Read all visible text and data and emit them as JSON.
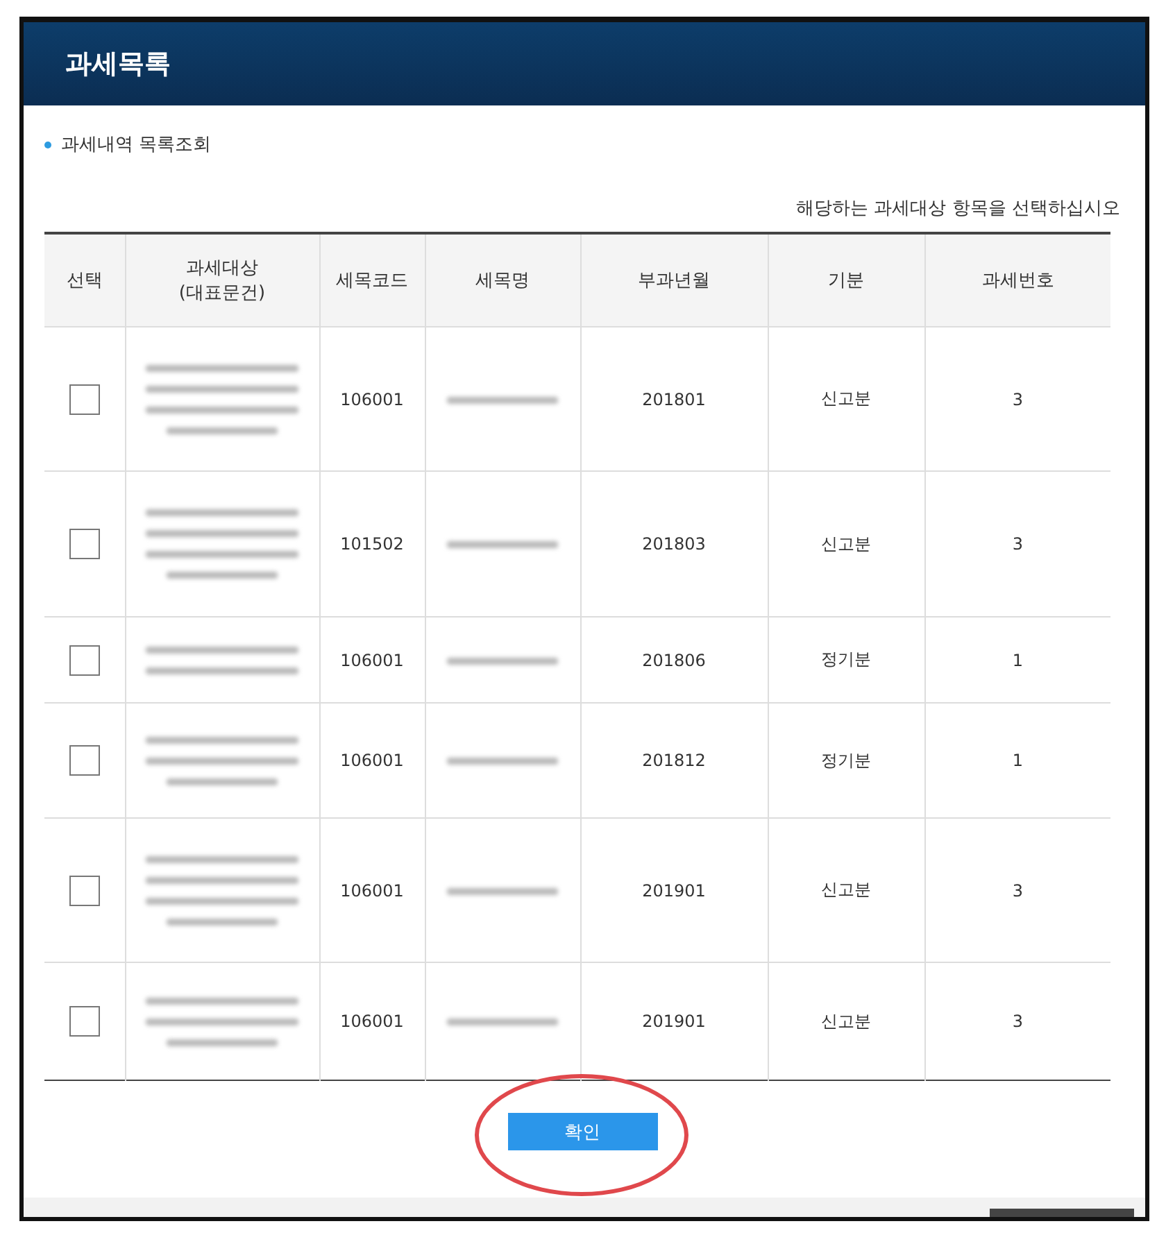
{
  "window": {
    "title": "과세목록"
  },
  "section_title": "과세내역 목록조회",
  "instruction": "해당하는 과세대상 항목을 선택하십시오",
  "table": {
    "columns": [
      "선택",
      "과세대상\n(대표문건)",
      "세목코드",
      "세목명",
      "부과년월",
      "기분",
      "과세번호"
    ],
    "rows": [
      {
        "checked": false,
        "code": "106001",
        "month": "201801",
        "period": "신고분",
        "number": "3"
      },
      {
        "checked": false,
        "code": "101502",
        "month": "201803",
        "period": "신고분",
        "number": "3"
      },
      {
        "checked": false,
        "code": "106001",
        "month": "201806",
        "period": "정기분",
        "number": "1"
      },
      {
        "checked": false,
        "code": "106001",
        "month": "201812",
        "period": "정기분",
        "number": "1"
      },
      {
        "checked": false,
        "code": "106001",
        "month": "201901",
        "period": "신고분",
        "number": "3"
      },
      {
        "checked": false,
        "code": "106001",
        "month": "201901",
        "period": "신고분",
        "number": "3"
      }
    ]
  },
  "confirm_button": "확인"
}
